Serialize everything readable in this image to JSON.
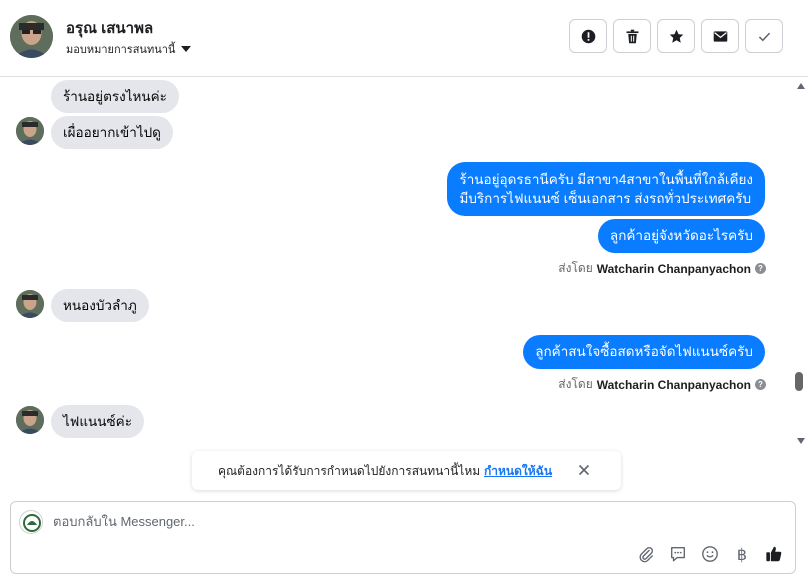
{
  "header": {
    "contact_name": "อรุณ เสนาพล",
    "assign_label": "มอบหมายการสนทนานี้",
    "actions": [
      "report-icon",
      "trash-icon",
      "star-icon",
      "envelope-icon",
      "check-icon"
    ]
  },
  "messages": {
    "in_1": "ร้านอยู่ตรงไหนค่ะ",
    "in_2": "เผื่ออยากเข้าไปดู",
    "out_1_line1": "ร้านอยู่อุดรธานีครับ มีสาขา4สาขาในพื้นที่ใกล้เคียง",
    "out_1_line2": "มีบริการไฟแนนซ์ เซ็นเอกสาร ส่งรถทั่วประเทศครับ",
    "out_2": "ลูกค้าอยู่จังหวัดอะไรครับ",
    "sent_by_prefix": "ส่งโดย",
    "sent_by_name": "Watcharin Chanpanyachon",
    "in_3": "หนองบัวลำภู",
    "out_3": "ลูกค้าสนใจซื้อสดหรือจัดไฟแนนซ์ครับ",
    "in_4": "ไฟแนนซ์ค่ะ"
  },
  "banner": {
    "text": "คุณต้องการได้รับการกำหนดไปยังการสนทนานี้ไหม",
    "link": "กำหนดให้ฉัน"
  },
  "composer": {
    "placeholder": "ตอบกลับใน Messenger...",
    "baht_symbol": "฿"
  },
  "colors": {
    "outgoing_bubble": "#0a7cff",
    "incoming_bubble": "#e4e6eb",
    "link": "#1877f2"
  }
}
